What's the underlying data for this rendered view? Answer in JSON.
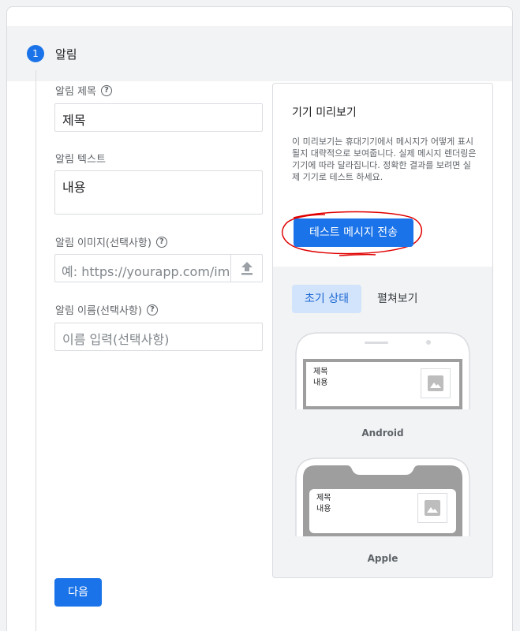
{
  "step": {
    "number": "1",
    "title": "알림"
  },
  "form": {
    "title_label": "알림 제목",
    "title_value": "제목",
    "text_label": "알림 텍스트",
    "text_value": "내용",
    "image_label": "알림 이미지(선택사항)",
    "image_placeholder": "예: https://yourapp.com/imag",
    "name_label": "알림 이름(선택사항)",
    "name_placeholder": "이름 입력(선택사항)",
    "help_glyph": "?",
    "next_label": "다음"
  },
  "preview": {
    "title": "기기 미리보기",
    "description": "이 미리보기는 휴대기기에서 메시지가 어떻게 표시될지 대략적으로 보여줍니다. 실제 메시지 렌더링은 기기에 따라 달라집니다. 정확한 결과를 보려면 실제 기기로 테스트 하세요.",
    "test_button": "테스트 메시지 전송",
    "tabs": [
      {
        "label": "초기 상태",
        "active": true
      },
      {
        "label": "펼쳐보기",
        "active": false
      }
    ],
    "android": {
      "label": "Android",
      "notif_title": "제목",
      "notif_body": "내용"
    },
    "apple": {
      "label": "Apple",
      "notif_title": "제목",
      "notif_body": "내용"
    }
  },
  "colors": {
    "accent": "#1a73e8",
    "tab_active_bg": "#d2e3fc",
    "annotation": "#e00000"
  },
  "icons": {
    "help": "help-circle-icon",
    "upload": "upload-icon",
    "image_placeholder": "image-icon"
  }
}
